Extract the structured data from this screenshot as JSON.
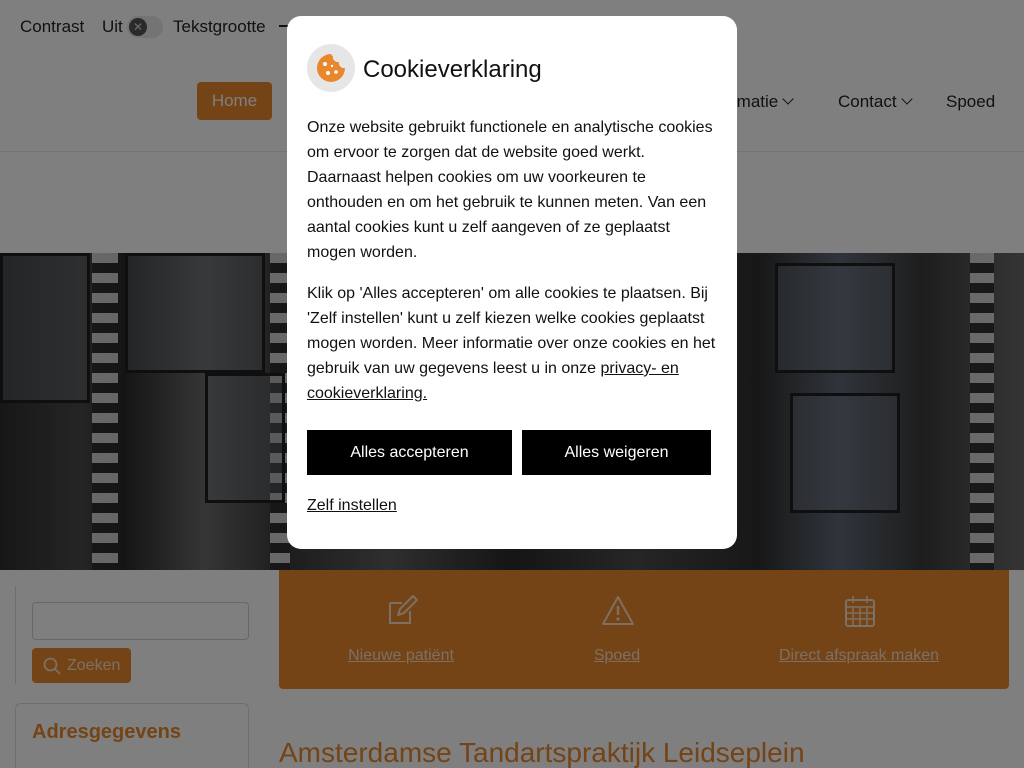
{
  "topbar": {
    "contrast_label": "Contrast",
    "contrast_state": "Uit",
    "fontsize_label": "Tekstgrootte"
  },
  "nav": {
    "home": "Home",
    "informatie_partial": "rmatie",
    "contact": "Contact",
    "spoed": "Spoed"
  },
  "quick_links": [
    {
      "label": "Nieuwe patiënt",
      "icon": "edit-icon"
    },
    {
      "label": "Spoed",
      "icon": "warning-icon"
    },
    {
      "label": "Direct afspraak maken",
      "icon": "calendar-icon"
    }
  ],
  "sidebar": {
    "search_button": "Zoeken",
    "address_title": "Adresgegevens"
  },
  "main": {
    "title": "Amsterdamse Tandartspraktijk Leidseplein"
  },
  "cookie_modal": {
    "title": "Cookieverklaring",
    "paragraph1": "Onze website gebruikt functionele en analytische cookies om ervoor te zorgen dat de website goed werkt. Daarnaast helpen cookies om uw voorkeuren te onthouden en om het gebruik te kunnen meten. Van een aantal cookies kunt u zelf aangeven of ze geplaatst mogen worden.",
    "paragraph2_text": "Klik op 'Alles accepteren' om alle cookies te plaatsen. Bij 'Zelf instellen' kunt u zelf kiezen welke cookies geplaatst mogen worden. Meer informatie over onze cookies en het gebruik van uw gegevens leest u in onze ",
    "privacy_link": "privacy- en cookieverklaring.",
    "accept_button": "Alles accepteren",
    "refuse_button": "Alles weigeren",
    "custom_link": "Zelf instellen"
  },
  "colors": {
    "accent": "#e8872c",
    "button_dark": "#000000",
    "overlay": "rgba(0,0,0,0.5)"
  }
}
